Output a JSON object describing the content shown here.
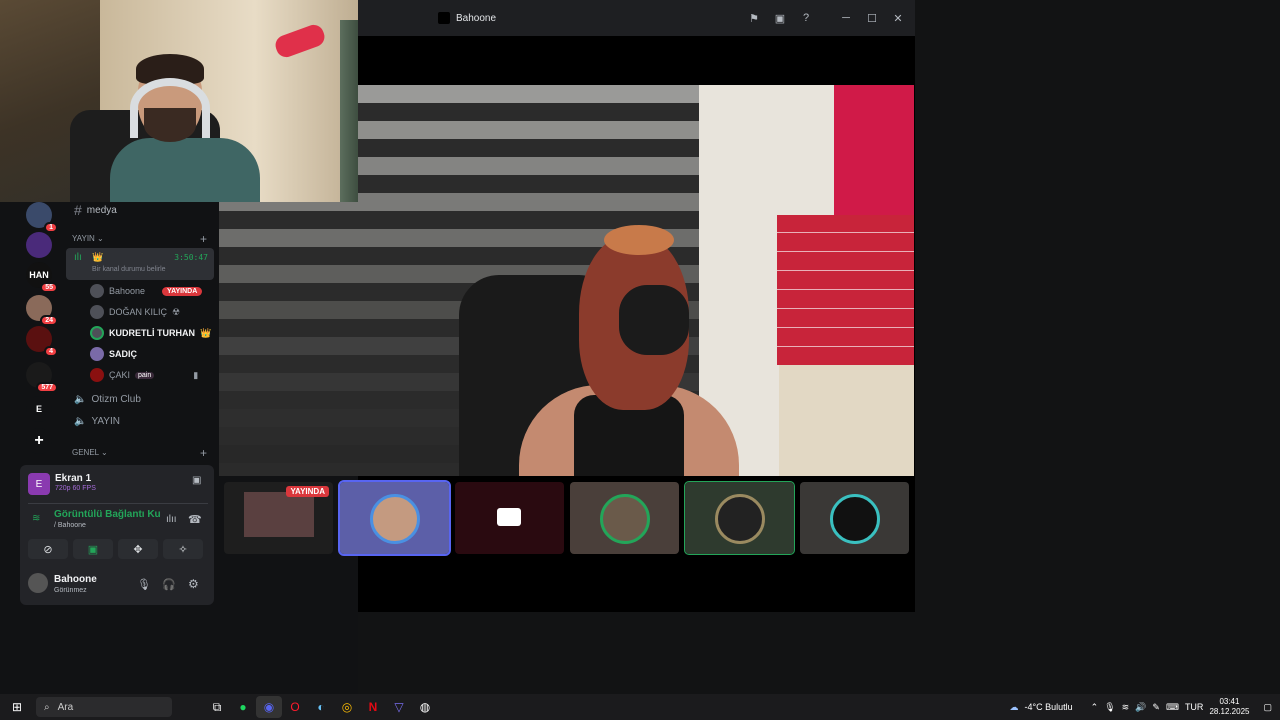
{
  "window": {
    "title": "Bahoone"
  },
  "stream_thumbnails": [
    {
      "label": "YAYINDA",
      "live": true
    },
    {
      "label": "",
      "live": false,
      "selected": true
    },
    {
      "label": "",
      "live": false
    },
    {
      "label": "",
      "live": false
    },
    {
      "label": "",
      "live": false
    },
    {
      "label": "",
      "live": false
    }
  ],
  "guilds": [
    {
      "label": "",
      "badge": "1"
    },
    {
      "label": "",
      "badge": ""
    },
    {
      "label": "HAN",
      "badge": "55"
    },
    {
      "label": "",
      "badge": "24"
    },
    {
      "label": "",
      "badge": "4"
    },
    {
      "label": "",
      "badge": "577"
    },
    {
      "label": "E",
      "badge": ""
    },
    {
      "label": "+",
      "badge": ""
    }
  ],
  "channels": {
    "text_channel": "medya",
    "category_yayin": "YAYIN",
    "voice_active": {
      "timer": "3:50:47",
      "status": "Bir kanal durumu belirle"
    },
    "members": [
      {
        "name": "Bahoone",
        "tag": "YAYINDA"
      },
      {
        "name": "DOĞAN KILIÇ",
        "tag": "☢"
      },
      {
        "name": "KUDRETLİ TURHAN",
        "tag": "👑"
      },
      {
        "name": "SADIÇ",
        "tag": ""
      },
      {
        "name": "ÇAKI",
        "tag": "pain"
      }
    ],
    "voice_channels": [
      "Otizm Club",
      "YAYIN"
    ],
    "category_genel": "GENEL"
  },
  "panel": {
    "screen_title": "Ekran 1",
    "screen_sub": "720p 60 FPS",
    "connection_title": "Görüntülü Bağlantı Ku",
    "connection_sub": "/ Bahoone",
    "user_name": "Bahoone",
    "user_status": "Görünmez"
  },
  "taskbar": {
    "search_placeholder": "Ara",
    "weather": "-4°C  Bulutlu",
    "lang": "TUR",
    "time": "03:41",
    "date": "28.12.2025"
  },
  "colors": {
    "accent": "#5865f2",
    "live": "#da373c",
    "online": "#23a559"
  }
}
